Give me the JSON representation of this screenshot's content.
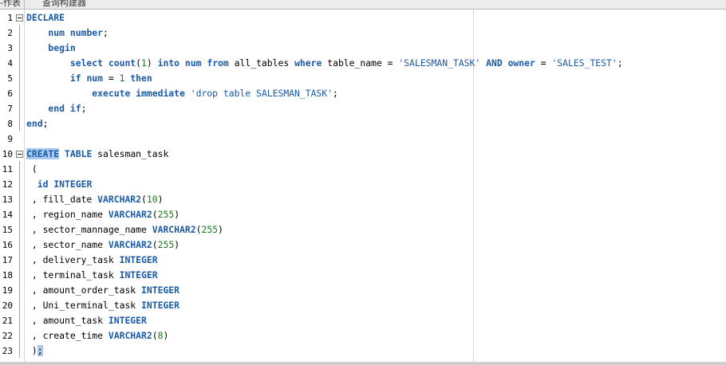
{
  "tabs": [
    {
      "label": "-作表"
    },
    {
      "label": "查询构建器"
    }
  ],
  "editor": {
    "lines": [
      {
        "n": "1",
        "fold": true,
        "tokens": [
          {
            "t": "DECLARE",
            "c": "kw"
          }
        ]
      },
      {
        "n": "2",
        "tokens": [
          {
            "t": "    num ",
            "c": "kw"
          },
          {
            "t": "number",
            "c": "kw"
          },
          {
            "t": ";",
            "c": ""
          }
        ]
      },
      {
        "n": "3",
        "tokens": [
          {
            "t": "    begin",
            "c": "kw"
          }
        ]
      },
      {
        "n": "4",
        "tokens": [
          {
            "t": "        select ",
            "c": "kw"
          },
          {
            "t": "count",
            "c": "fn"
          },
          {
            "t": "(",
            "c": ""
          },
          {
            "t": "1",
            "c": "num"
          },
          {
            "t": ") ",
            "c": ""
          },
          {
            "t": "into ",
            "c": "kw"
          },
          {
            "t": "num ",
            "c": "kw"
          },
          {
            "t": "from ",
            "c": "kw"
          },
          {
            "t": "all_tables ",
            "c": ""
          },
          {
            "t": "where ",
            "c": "kw"
          },
          {
            "t": "table_name = ",
            "c": ""
          },
          {
            "t": "'SALESMAN_TASK'",
            "c": "str"
          },
          {
            "t": " ",
            "c": ""
          },
          {
            "t": "AND ",
            "c": "kw"
          },
          {
            "t": "owner ",
            "c": "kw"
          },
          {
            "t": "= ",
            "c": ""
          },
          {
            "t": "'SALES_TEST'",
            "c": "str"
          },
          {
            "t": ";",
            "c": ""
          }
        ]
      },
      {
        "n": "5",
        "tokens": [
          {
            "t": "        if ",
            "c": "kw"
          },
          {
            "t": "num ",
            "c": "kw"
          },
          {
            "t": "= ",
            "c": ""
          },
          {
            "t": "1",
            "c": "num"
          },
          {
            "t": " ",
            "c": ""
          },
          {
            "t": "then",
            "c": "kw"
          }
        ]
      },
      {
        "n": "6",
        "tokens": [
          {
            "t": "            execute ",
            "c": "kw"
          },
          {
            "t": "immediate ",
            "c": "kw"
          },
          {
            "t": "'drop table SALESMAN_TASK'",
            "c": "str"
          },
          {
            "t": ";",
            "c": ""
          }
        ]
      },
      {
        "n": "7",
        "tokens": [
          {
            "t": "    end ",
            "c": "kw"
          },
          {
            "t": "if",
            "c": "kw"
          },
          {
            "t": ";",
            "c": ""
          }
        ]
      },
      {
        "n": "8",
        "tokens": [
          {
            "t": "end",
            "c": "kw"
          },
          {
            "t": ";",
            "c": ""
          }
        ]
      },
      {
        "n": "9",
        "tokens": []
      },
      {
        "n": "10",
        "fold": true,
        "tokens": [
          {
            "t": "CREATE",
            "c": "kw hl"
          },
          {
            "t": " ",
            "c": ""
          },
          {
            "t": "TABLE ",
            "c": "kw"
          },
          {
            "t": "salesman_task",
            "c": ""
          }
        ]
      },
      {
        "n": "11",
        "tokens": [
          {
            "t": " (",
            "c": ""
          }
        ]
      },
      {
        "n": "12",
        "tokens": [
          {
            "t": "  id ",
            "c": "kw"
          },
          {
            "t": "INTEGER",
            "c": "kw"
          }
        ]
      },
      {
        "n": "13",
        "tokens": [
          {
            "t": " , fill_date ",
            "c": ""
          },
          {
            "t": "VARCHAR2",
            "c": "kw"
          },
          {
            "t": "(",
            "c": ""
          },
          {
            "t": "10",
            "c": "num"
          },
          {
            "t": ")",
            "c": ""
          }
        ]
      },
      {
        "n": "14",
        "tokens": [
          {
            "t": " , region_name ",
            "c": ""
          },
          {
            "t": "VARCHAR2",
            "c": "kw"
          },
          {
            "t": "(",
            "c": ""
          },
          {
            "t": "255",
            "c": "num"
          },
          {
            "t": ")",
            "c": ""
          }
        ]
      },
      {
        "n": "15",
        "tokens": [
          {
            "t": " , sector_mannage_name ",
            "c": ""
          },
          {
            "t": "VARCHAR2",
            "c": "kw"
          },
          {
            "t": "(",
            "c": ""
          },
          {
            "t": "255",
            "c": "num"
          },
          {
            "t": ")",
            "c": ""
          }
        ]
      },
      {
        "n": "16",
        "tokens": [
          {
            "t": " , sector_name ",
            "c": ""
          },
          {
            "t": "VARCHAR2",
            "c": "kw"
          },
          {
            "t": "(",
            "c": ""
          },
          {
            "t": "255",
            "c": "num"
          },
          {
            "t": ")",
            "c": ""
          }
        ]
      },
      {
        "n": "17",
        "tokens": [
          {
            "t": " , delivery_task ",
            "c": ""
          },
          {
            "t": "INTEGER",
            "c": "kw"
          }
        ]
      },
      {
        "n": "18",
        "tokens": [
          {
            "t": " , terminal_task ",
            "c": ""
          },
          {
            "t": "INTEGER",
            "c": "kw"
          }
        ]
      },
      {
        "n": "19",
        "tokens": [
          {
            "t": " , amount_order_task ",
            "c": ""
          },
          {
            "t": "INTEGER",
            "c": "kw"
          }
        ]
      },
      {
        "n": "20",
        "tokens": [
          {
            "t": " , Uni_terminal_task ",
            "c": ""
          },
          {
            "t": "INTEGER",
            "c": "kw"
          }
        ]
      },
      {
        "n": "21",
        "tokens": [
          {
            "t": " , amount_task ",
            "c": ""
          },
          {
            "t": "INTEGER",
            "c": "kw"
          }
        ]
      },
      {
        "n": "22",
        "tokens": [
          {
            "t": " , create_time ",
            "c": ""
          },
          {
            "t": "VARCHAR2",
            "c": "kw"
          },
          {
            "t": "(",
            "c": ""
          },
          {
            "t": "8",
            "c": "num"
          },
          {
            "t": ")",
            "c": ""
          }
        ]
      },
      {
        "n": "23",
        "tokens": [
          {
            "t": " )",
            "c": ""
          },
          {
            "t": ";",
            "c": "caret"
          }
        ]
      }
    ]
  }
}
